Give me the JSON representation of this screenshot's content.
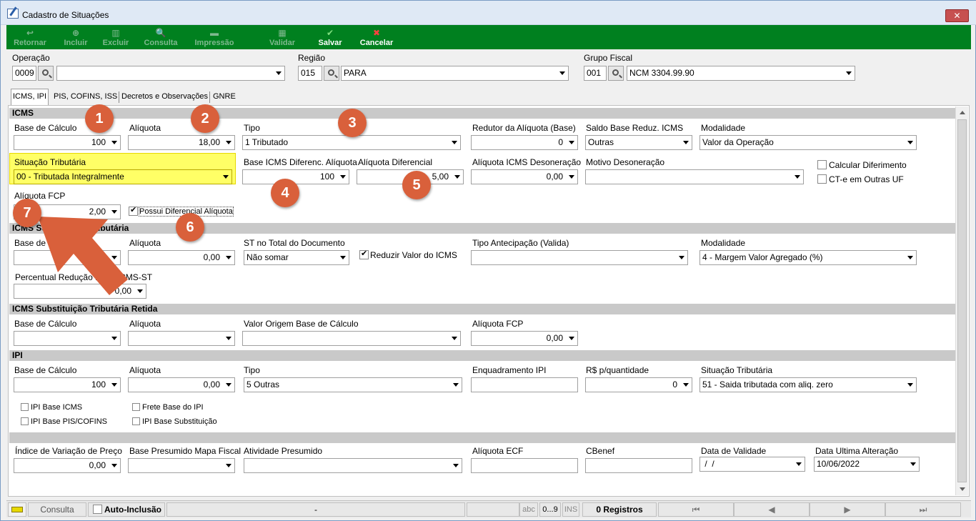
{
  "window": {
    "title": "Cadastro de Situações",
    "close_label": "✕"
  },
  "toolbar": [
    {
      "label": "Retornar",
      "icon": "↩",
      "enabled": false
    },
    {
      "label": "Incluir",
      "icon": "⊕",
      "enabled": false
    },
    {
      "label": "Excluir",
      "icon": "▥",
      "enabled": false
    },
    {
      "label": "Consulta",
      "icon": "🔍",
      "enabled": false
    },
    {
      "label": "Impressão",
      "icon": "▬",
      "enabled": false
    },
    {
      "label": "Validar",
      "icon": "▦",
      "enabled": false
    },
    {
      "label": "Salvar",
      "icon": "✔",
      "enabled": true
    },
    {
      "label": "Cancelar",
      "icon": "✖",
      "enabled": true
    }
  ],
  "header": {
    "operacao": {
      "label": "Operação",
      "code": "0009",
      "desc": ""
    },
    "regiao": {
      "label": "Região",
      "code": "015",
      "desc": "PARA"
    },
    "grupo_fiscal": {
      "label": "Grupo Fiscal",
      "code": "001",
      "desc": "NCM 3304.99.90"
    }
  },
  "tabs": [
    "ICMS, IPI",
    "PIS, COFINS, ISS",
    "Decretos e Observações",
    "GNRE"
  ],
  "icms": {
    "section": "ICMS",
    "base_calculo": {
      "label": "Base de Cálculo",
      "value": "100"
    },
    "aliquota": {
      "label": "Alíquota",
      "value": "18,00"
    },
    "tipo": {
      "label": "Tipo",
      "value": "1 Tributado"
    },
    "redutor": {
      "label": "Redutor da Alíquota (Base)",
      "value": "0"
    },
    "saldo_base": {
      "label": "Saldo Base Reduz. ICMS",
      "value": "Outras"
    },
    "modalidade": {
      "label": "Modalidade",
      "value": "Valor da Operação"
    },
    "situacao": {
      "label": "Situação Tributária",
      "value": "00 - Tributada Integralmente"
    },
    "base_difer": {
      "label": "Base ICMS Diferenc. Alíquota",
      "value": "100"
    },
    "aliq_difer": {
      "label": "Alíquota Diferencial",
      "value": "5,00"
    },
    "aliq_deson": {
      "label": "Alíquota ICMS Desoneração",
      "value": "0,00"
    },
    "motivo_deson": {
      "label": "Motivo Desoneração",
      "value": ""
    },
    "calc_diferimento": "Calcular Diferimento",
    "cte_outras": "CT-e em Outras UF",
    "aliq_fcp": {
      "label": "Alíquota FCP",
      "value": "2,00"
    },
    "possui_difer": "Possui Diferencial Alíquota"
  },
  "st": {
    "section": "ICMS Substituição Tributária",
    "base_calculo": {
      "label": "Base de Cálculo",
      "value": "0"
    },
    "aliquota": {
      "label": "Alíquota",
      "value": "0,00"
    },
    "st_total": {
      "label": "ST no Total do Documento",
      "value": "Não somar"
    },
    "reduzir": "Reduzir Valor do ICMS",
    "tipo_antecip": {
      "label": "Tipo Antecipação (Valida)",
      "value": ""
    },
    "modalidade": {
      "label": "Modalidade",
      "value": "4 - Margem Valor Agregado (%)"
    },
    "perc_reducao": {
      "label": "Percentual Redução Base ICMS-ST",
      "value": "0,00"
    }
  },
  "st_retida": {
    "section": "ICMS Substituição Tributária Retida",
    "base_calculo": {
      "label": "Base de Cálculo",
      "value": ""
    },
    "aliquota": {
      "label": "Alíquota",
      "value": ""
    },
    "valor_origem": {
      "label": "Valor Origem Base de Cálculo",
      "value": ""
    },
    "aliq_fcp": {
      "label": "Alíquota FCP",
      "value": "0,00"
    }
  },
  "ipi": {
    "section": "IPI",
    "base_calculo": {
      "label": "Base de Cálculo",
      "value": "100"
    },
    "aliquota": {
      "label": "Alíquota",
      "value": "0,00"
    },
    "tipo": {
      "label": "Tipo",
      "value": "5 Outras"
    },
    "enquadramento": {
      "label": "Enquadramento IPI",
      "value": ""
    },
    "rs_qtd": {
      "label": "R$ p/quantidade",
      "value": "0"
    },
    "situacao": {
      "label": "Situação Tributária",
      "value": "51 - Saida tributada com aliq. zero"
    },
    "cb_base_icms": "IPI Base ICMS",
    "cb_frete": "Frete Base do IPI",
    "cb_pis": "IPI Base PIS/COFINS",
    "cb_subst": "IPI Base Substituição"
  },
  "outros": {
    "indice": {
      "label": "Índice de Variação de Preço",
      "value": "0,00"
    },
    "base_presumido": {
      "label": "Base Presumido Mapa Fiscal",
      "value": ""
    },
    "atividade": {
      "label": "Atividade Presumido",
      "value": ""
    },
    "aliq_ecf": {
      "label": "Alíquota ECF",
      "value": ""
    },
    "cbenef": {
      "label": "CBenef",
      "value": ""
    },
    "data_validade": {
      "label": "Data de Validade",
      "value": " /  /"
    },
    "data_ultima": {
      "label": "Data Ultima Alteração",
      "value": "10/06/2022"
    }
  },
  "status": {
    "consulta": "Consulta",
    "auto_inclusao": "Auto-Inclusão",
    "dash": "-",
    "abc": "abc",
    "num": "0...9",
    "ins": "INS",
    "registros": "0 Registros",
    "nav_first": "⏮",
    "nav_prev": "◀",
    "nav_next": "▶",
    "nav_last": "⏭"
  },
  "annotations": [
    "1",
    "2",
    "3",
    "4",
    "5",
    "6",
    "7"
  ],
  "colors": {
    "toolbar": "#00801f",
    "badge": "#d9603b",
    "highlight": "#ffff66"
  }
}
